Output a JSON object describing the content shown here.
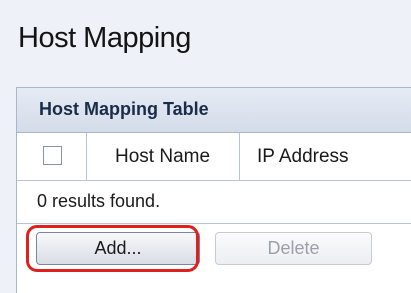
{
  "page": {
    "title": "Host Mapping"
  },
  "table": {
    "title": "Host Mapping Table",
    "columns": [
      "Host Name",
      "IP Address"
    ],
    "results_text": "0 results found."
  },
  "buttons": {
    "add_label": "Add...",
    "delete_label": "Delete"
  },
  "colors": {
    "highlight": "#e0201b",
    "header_text": "#1b2b4a",
    "page_background": "#eef1f7"
  },
  "icons": {
    "select_all": "checkbox-empty-icon"
  }
}
